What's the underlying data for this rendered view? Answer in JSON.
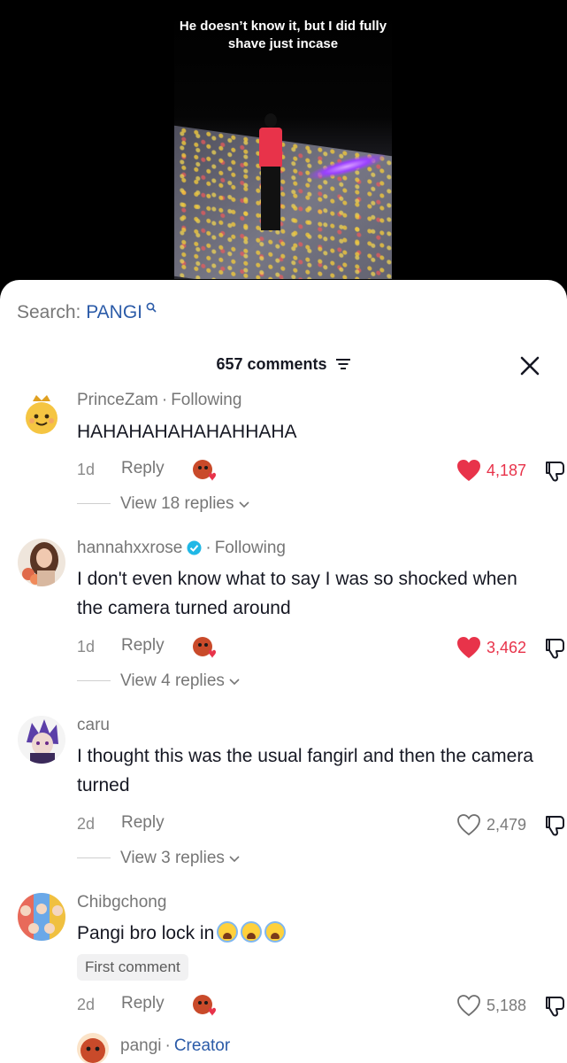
{
  "video": {
    "caption": "He doesn’t know it, but I did fully shave just incase"
  },
  "search": {
    "label": "Search:",
    "keyword": "PANGI"
  },
  "comments_header": {
    "count_label": "657 comments"
  },
  "colors": {
    "like_red": "#e8334a",
    "link_blue": "#2b5ba8",
    "verified_teal": "#20b8e6"
  },
  "comments": [
    {
      "username": "PrinceZam",
      "relation": "Following",
      "text": "HAHAHAHAHAHAHHAHA",
      "time": "1d",
      "reply_label": "Reply",
      "likes": "4,187",
      "liked": true,
      "replies_label": "View 18 replies"
    },
    {
      "username": "hannahxxrose",
      "verified": true,
      "relation": "Following",
      "text": "I don't even know what to say I was so shocked when the camera turned around",
      "time": "1d",
      "reply_label": "Reply",
      "likes": "3,462",
      "liked": true,
      "replies_label": "View 4 replies"
    },
    {
      "username": "caru",
      "text": "I thought this was the usual fangirl and then the camera turned",
      "time": "2d",
      "reply_label": "Reply",
      "likes": "2,479",
      "liked": false,
      "replies_label": "View 3 replies"
    },
    {
      "username": "Chibgchong",
      "text": "Pangi bro lock in",
      "emojis": [
        "loudly-crying-face",
        "loudly-crying-face",
        "loudly-crying-face"
      ],
      "badge": "First comment",
      "time": "2d",
      "reply_label": "Reply",
      "likes": "5,188",
      "liked": false
    }
  ],
  "creator_reply": {
    "username": "pangi",
    "role": "Creator"
  }
}
